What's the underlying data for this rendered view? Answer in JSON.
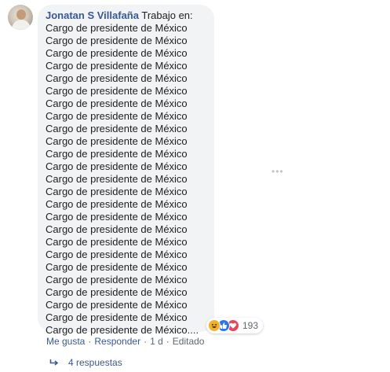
{
  "comment": {
    "author": "Jonatan S Villafaña",
    "lines": [
      "Trabajo en:",
      "Cargo de presidente de México",
      "Cargo de presidente de México",
      "Cargo de presidente de México",
      "Cargo de presidente de México",
      "Cargo de presidente de México",
      "Cargo de presidente de México",
      "Cargo de presidente de México",
      "Cargo de presidente de México",
      "Cargo de presidente de México",
      "Cargo de presidente de México",
      "Cargo de presidente de México",
      "Cargo de presidente de México",
      "Cargo de presidente de México",
      "Cargo de presidente de México",
      "Cargo de presidente de México",
      "Cargo de presidente de México",
      "Cargo de presidente de México",
      "Cargo de presidente de México",
      "Cargo de presidente de México",
      "Cargo de presidente de México",
      "Cargo de presidente de México",
      "Cargo de presidente de México",
      "Cargo de presidente de México",
      "Cargo de presidente de México",
      "Cargo de presidente de México...."
    ],
    "more_options_icon": "ellipsis-icon",
    "reactions": {
      "icons": [
        "haha-icon",
        "like-icon",
        "love-icon"
      ],
      "count": "193",
      "colors": {
        "haha": "#f7b125",
        "like": "#2078f4",
        "love": "#f33e58"
      }
    },
    "actions": {
      "like": "Me gusta",
      "reply": "Responder",
      "time": "1 d",
      "edited": "Editado",
      "separator": "·"
    },
    "replies": {
      "icon": "reply-arrow-icon",
      "label": "4 respuestas"
    }
  },
  "colors": {
    "link": "#385898",
    "bubble": "#f2f3f5",
    "meta": "#606770"
  }
}
